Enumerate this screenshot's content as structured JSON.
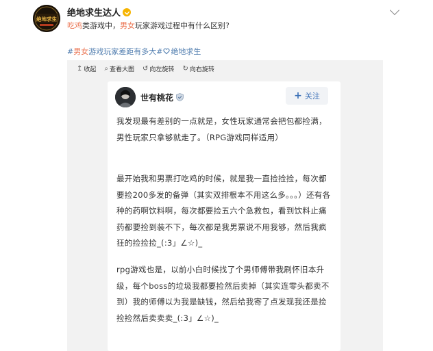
{
  "post": {
    "author": "绝地求生达人",
    "avatar_logo_text": "绝地求生",
    "text_segments": [
      {
        "text": "吃鸡",
        "highlight": true
      },
      {
        "text": "类游戏中，",
        "highlight": false
      },
      {
        "text": "男女",
        "highlight": true
      },
      {
        "text": "玩家游戏过程中有什么区别?",
        "highlight": false
      }
    ],
    "topics": {
      "t1_prefix": "#",
      "t1_highlight": "男女",
      "t1_rest": "游戏玩家差距有多大#",
      "t2": "绝地求生"
    }
  },
  "viewer": {
    "toolbar": [
      {
        "icon": "↥",
        "label": "收起"
      },
      {
        "icon": "⌕",
        "label": "查看大图"
      },
      {
        "icon": "↺",
        "label": "向左旋转"
      },
      {
        "icon": "↻",
        "label": "向右旋转"
      }
    ]
  },
  "card": {
    "author": "世有桃花",
    "follow_label": "关注",
    "paragraphs": [
      "我发现最有差别的一点就是，女性玩家通常会把包都捡满，男性玩家只拿够就走了。（RPG游戏同样适用）",
      "最开始我和男票打吃鸡的时候，就是我一直捡捡捡，每次都要捡200多发的备弹（其实双排根本不用这么多。。。）还有各种的药啊饮料啊，每次都要捡五六个急救包，看到饮料止痛药都要捡到装不下，每次都是我男票说不用我够，然后我疯狂的捡捡捡_(:3」∠☆)_",
      "rpg游戏也是，以前小白时候找了个男师傅带我刷怀旧本升级，每个boss的垃圾我都要捡然后卖掉（其实连零头都卖不到）我的师傅以为我是缺钱，然后给我寄了点发现我还是捡捡捡然后卖卖卖_(:3」∠☆)_"
    ]
  },
  "colors": {
    "highlight": "#eb7350",
    "topic": "#507daf",
    "follow": "#3a6fb6",
    "vip": "#f6b400"
  }
}
